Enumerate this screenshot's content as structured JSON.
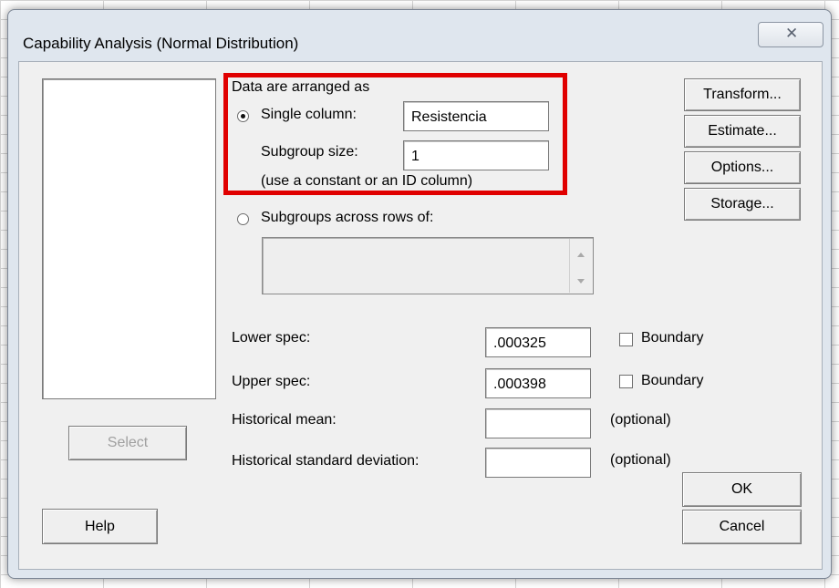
{
  "dialog": {
    "title": "Capability Analysis (Normal Distribution)",
    "close_glyph": "✕"
  },
  "left": {
    "select_label": "Select",
    "help_label": "Help"
  },
  "arrangement": {
    "heading": "Data are arranged as",
    "single_column_label": "Single column:",
    "single_column_value": "Resistencia",
    "single_column_selected": true,
    "subgroup_size_label": "Subgroup size:",
    "subgroup_size_value": "1",
    "hint": "(use a constant or an ID column)",
    "subgroups_across_label": "Subgroups across rows of:",
    "subgroups_across_value": ""
  },
  "specs": {
    "lower_label": "Lower spec:",
    "lower_value": ".000325",
    "upper_label": "Upper spec:",
    "upper_value": ".000398",
    "boundary_label": "Boundary",
    "hist_mean_label": "Historical mean:",
    "hist_mean_value": "",
    "hist_sd_label": "Historical standard deviation:",
    "hist_sd_value": "",
    "optional_label": "(optional)"
  },
  "right_buttons": {
    "transform": "Transform...",
    "estimate": "Estimate...",
    "options": "Options...",
    "storage": "Storage...",
    "ok": "OK",
    "cancel": "Cancel"
  },
  "colors": {
    "highlight": "#e00000",
    "dialog_frame": "#dfe6ee",
    "client_bg": "#f0f0f0"
  }
}
